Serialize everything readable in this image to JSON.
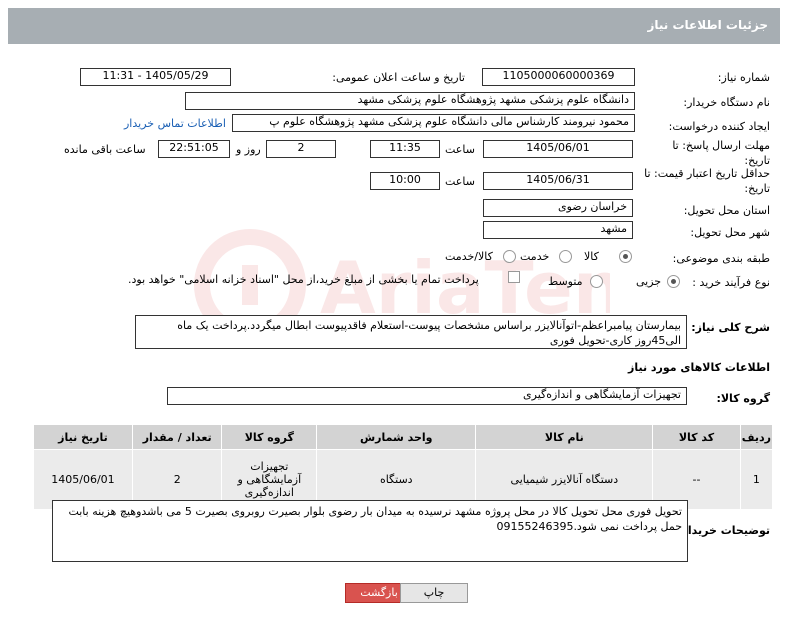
{
  "page": {
    "title": "جزئیات اطلاعات نیاز"
  },
  "fields": {
    "need_number_label": "شماره نیاز:",
    "need_number": "1105000060000369",
    "announce_label": "تاریخ و ساعت اعلان عمومی:",
    "announce_value": "1405/05/29 - 11:31",
    "buyer_org_label": "نام دستگاه خریدار:",
    "buyer_org": "دانشگاه علوم پزشکی مشهد   پژوهشگاه علوم پزشکی مشهد",
    "creator_label": "ایجاد کننده درخواست:",
    "creator": "محمود نیرومند کارشناس مالی دانشگاه علوم پزشکی مشهد   پژوهشگاه علوم پ",
    "contact_link": "اطلاعات تماس خریدار",
    "deadline_label": "مهلت ارسال پاسخ: تا تاریخ:",
    "deadline_date": "1405/06/01",
    "time_label": "ساعت",
    "deadline_time": "11:35",
    "days_value": "2",
    "days_label": "روز و",
    "remaining_time": "22:51:05",
    "remaining_label": "ساعت باقی مانده",
    "validity_label": "حداقل تاریخ اعتبار قیمت: تا تاریخ:",
    "validity_date": "1405/06/31",
    "validity_time": "10:00",
    "province_label": "استان محل تحویل:",
    "province": "خراسان رضوی",
    "city_label": "شهر محل تحویل:",
    "city": "مشهد",
    "category_label": "طبقه بندی موضوعی:",
    "category_options": [
      "کالا",
      "خدمت",
      "کالا/خدمت"
    ],
    "category_selected": "کالا",
    "process_label": "نوع فرآیند خرید :",
    "process_options": [
      "جزیی",
      "متوسط"
    ],
    "process_selected": "جزیی",
    "payment_note": "پرداخت تمام یا بخشی از مبلغ خرید،از محل \"اسناد خزانه اسلامی\" خواهد بود."
  },
  "description": {
    "label": "شرح کلی نیاز:",
    "text": "بیمارستان پیامبراعظم-اتوآنالایزر براساس مشخصات پیوست-استعلام فاقدپیوست ابطال میگردد.پرداخت یک ماه الی45روز کاری-تحویل فوری"
  },
  "goods_info": {
    "heading": "اطلاعات کالاهای مورد نیاز",
    "group_label": "گروه کالا:",
    "group_value": "تجهیزات آزمایشگاهی و اندازه‌گیری"
  },
  "table": {
    "headers": [
      "ردیف",
      "کد کالا",
      "نام کالا",
      "واحد شمارش",
      "گروه کالا",
      "تعداد / مقدار",
      "تاریخ نیاز"
    ],
    "rows": [
      [
        "1",
        "--",
        "دستگاه آنالایزر شیمیایی",
        "دستگاه",
        "تجهیزات آزمایشگاهی و اندازه‌گیری",
        "2",
        "1405/06/01"
      ]
    ]
  },
  "buyer_notes": {
    "label": "توضیحات خریدار:",
    "text": "تحویل فوری محل تحویل کالا در محل پروژه  مشهد نرسیده به میدان بار رضوی بلوار بصیرت روبروی بصیرت 5 می باشدوهیچ هزینه بابت حمل  پرداخت نمی شود.09155246395"
  },
  "buttons": {
    "print": "چاپ",
    "return": "بازگشت"
  },
  "colors": {
    "title_bg": "#a7aeb3",
    "header_bg": "#d3d3d3",
    "row_bg": "#ebebeb",
    "return_btn": "#d9534f"
  }
}
